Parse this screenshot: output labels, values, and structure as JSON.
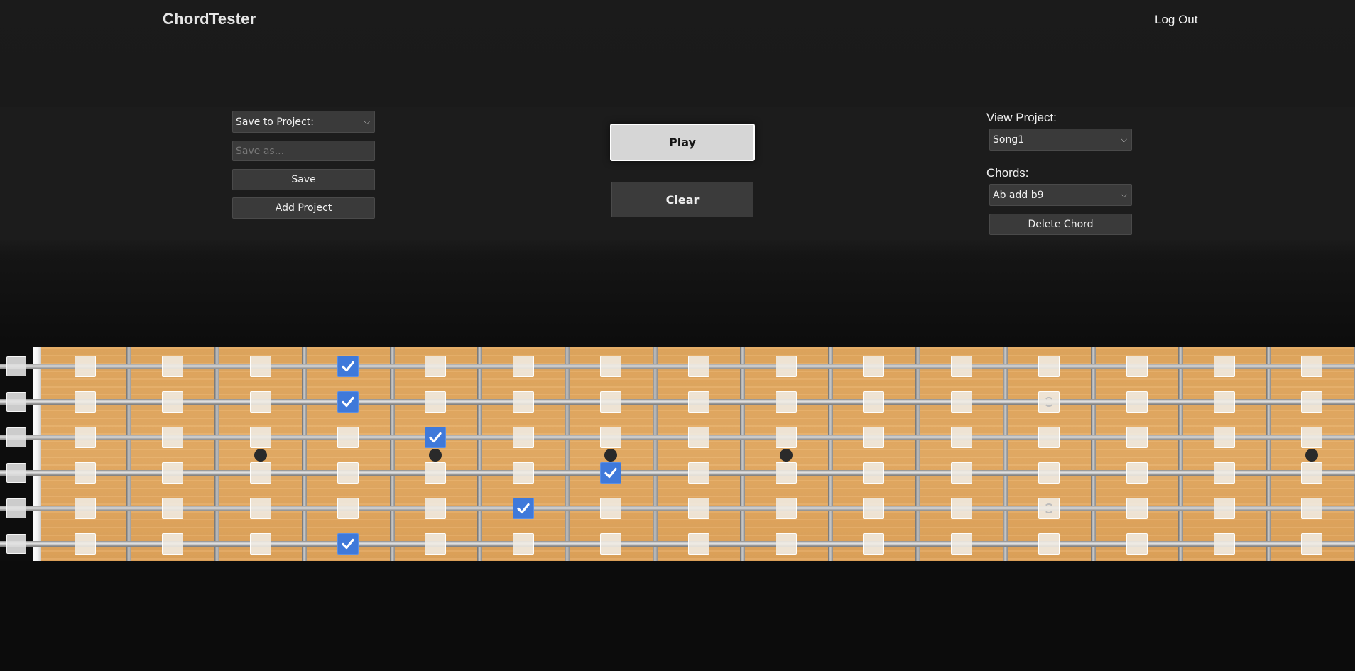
{
  "header": {
    "brand": "ChordTester",
    "logout_label": "Log Out"
  },
  "save_panel": {
    "project_select_value": "Save to Project:",
    "save_as_placeholder": "Save as...",
    "save_label": "Save",
    "add_project_label": "Add Project"
  },
  "center_panel": {
    "play_label": "Play",
    "clear_label": "Clear"
  },
  "view_panel": {
    "view_project_label": "View Project:",
    "project_value": "Song1",
    "chords_label": "Chords:",
    "chord_value": "Ab add b9",
    "delete_chord_label": "Delete Chord"
  },
  "fretboard": {
    "string_count": 6,
    "fret_count": 15,
    "checked_notes": [
      {
        "string": 1,
        "fret": 4
      },
      {
        "string": 2,
        "fret": 4
      },
      {
        "string": 3,
        "fret": 5
      },
      {
        "string": 4,
        "fret": 7
      },
      {
        "string": 5,
        "fret": 6
      },
      {
        "string": 6,
        "fret": 4
      }
    ],
    "partial_notes": [
      {
        "string": 2,
        "fret": 12
      },
      {
        "string": 5,
        "fret": 12
      }
    ],
    "inlay_frets": [
      3,
      5,
      7,
      9,
      15
    ],
    "colors": {
      "wood": "#e4aa62",
      "checked": "#3f79da",
      "inlay": "#2a2a2a"
    }
  }
}
